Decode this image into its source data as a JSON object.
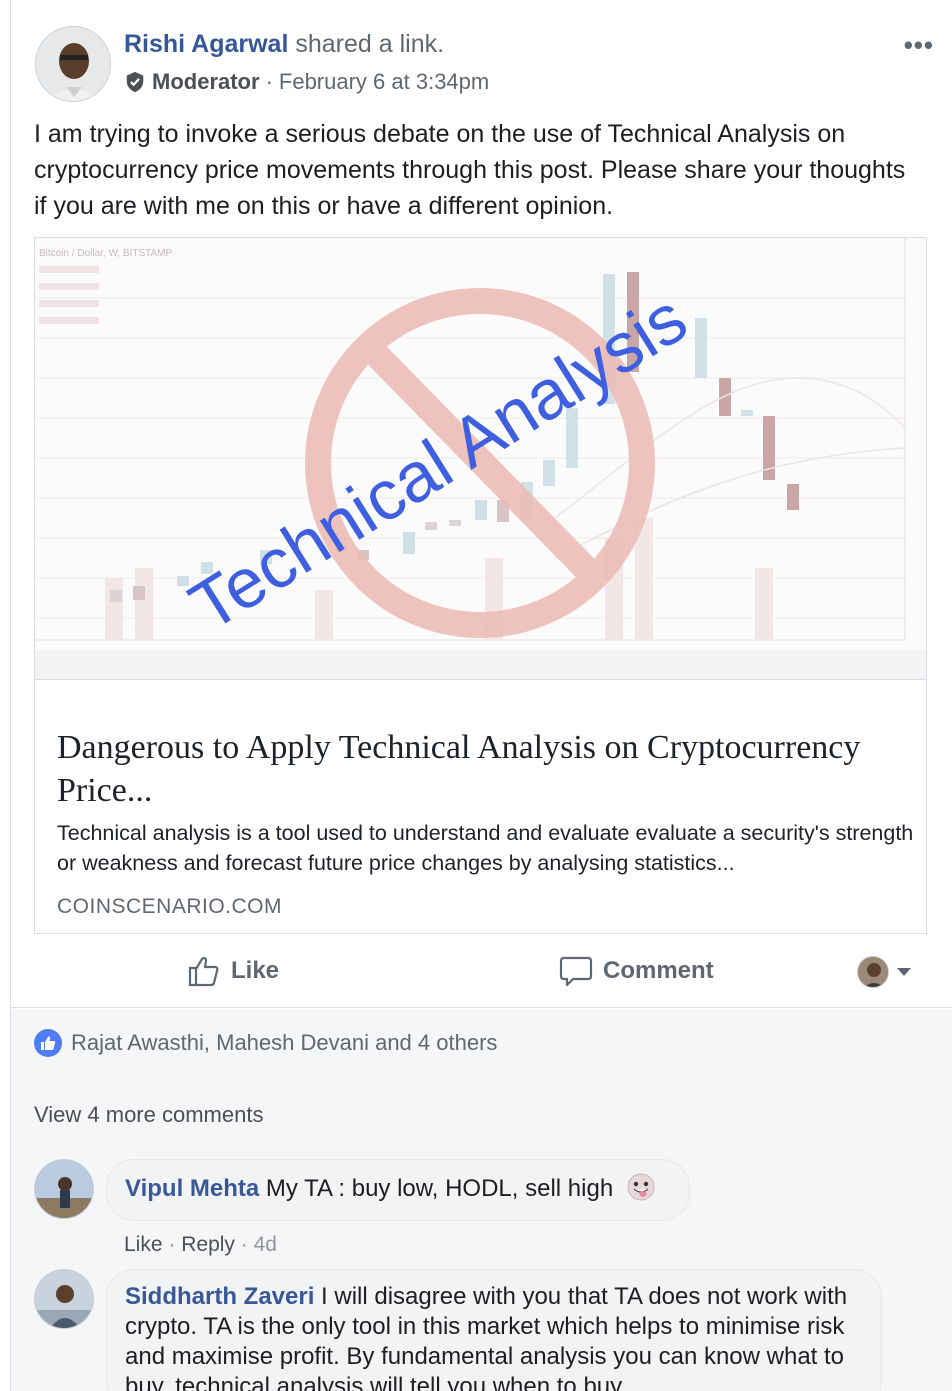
{
  "post": {
    "author": "Rishi Agarwal",
    "action_text": "shared a link.",
    "role": "Moderator",
    "separator": "·",
    "timestamp": "February 6 at 3:34pm",
    "more_label": "•••",
    "text": "I am trying to invoke a serious debate on the use of Technical Analysis on cryptocurrency price movements through this post. Please share your thoughts if you are with me on this or have a different opinion."
  },
  "link": {
    "image": {
      "chart_header": "Bitcoin / Dollar, W, BITSTAMP",
      "overlay_text": "Technical Analysis",
      "prohibition_color": "#e8a9a4",
      "overlay_color": "#3d5fe0"
    },
    "title": "Dangerous to Apply Technical Analysis on Cryptocurrency Price...",
    "description": "Technical analysis is a tool used to understand and evaluate evaluate a security's strength or weakness and forecast future price changes by analysing statistics...",
    "domain": "COINSCENARIO.COM"
  },
  "actions": {
    "like": "Like",
    "comment": "Comment",
    "like_icon": "thumbs-up-icon",
    "comment_icon": "speech-bubble-icon"
  },
  "reactions": {
    "text": "Rajat Awasthi, Mahesh Devani and 4 others"
  },
  "view_more": "View 4 more comments",
  "comments": [
    {
      "author": "Vipul Mehta",
      "text": "My TA : buy low, HODL, sell high",
      "like": "Like",
      "reply": "Reply",
      "sep": "·",
      "age": "4d"
    },
    {
      "author": "Siddharth Zaveri",
      "text": "I will disagree with you that TA does not work with crypto. TA is the only tool in this market which helps to minimise risk and maximise profit. By fundamental analysis you can know what to buy, technical analysis will tell you when to buy"
    }
  ]
}
